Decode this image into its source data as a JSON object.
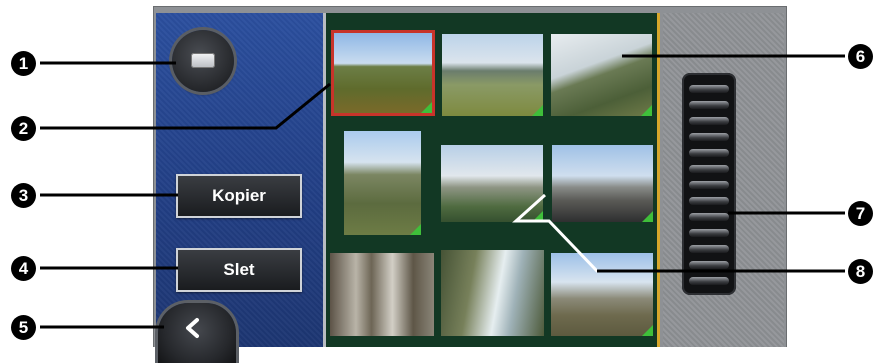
{
  "buttons": {
    "copy_label": "Kopier",
    "delete_label": "Slet"
  },
  "callouts": [
    "1",
    "2",
    "3",
    "4",
    "5",
    "6",
    "7",
    "8"
  ],
  "icons": {
    "view_mode": "screen-icon",
    "back": "chevron-left-icon",
    "scroll": "scroll-wheel",
    "thumbnail_marker": "green-corner-triangle"
  },
  "colors": {
    "selection_border": "#c8342a",
    "thumbnail_marker": "#3fbf3a",
    "panel_blue": "#2b4f9f",
    "grid_background": "#123824",
    "separator": "#d7a72c"
  },
  "thumbnails": [
    {
      "id": "photo-1",
      "selected": true
    },
    {
      "id": "photo-2",
      "selected": false
    },
    {
      "id": "photo-3",
      "selected": false
    },
    {
      "id": "photo-4",
      "selected": false
    },
    {
      "id": "photo-5",
      "selected": false
    },
    {
      "id": "photo-6",
      "selected": false
    },
    {
      "id": "photo-7",
      "selected": false
    },
    {
      "id": "photo-8",
      "selected": false
    },
    {
      "id": "photo-9",
      "selected": false
    }
  ]
}
